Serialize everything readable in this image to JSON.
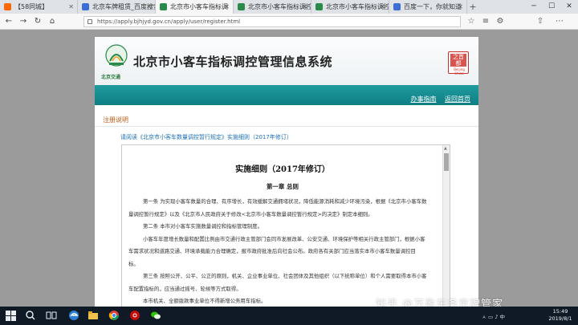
{
  "browser": {
    "tabs": [
      {
        "label": "【58同城】",
        "active": false,
        "favicon_color": "#ff6600"
      },
      {
        "label": "北京车牌租赁_百度搜索",
        "active": false,
        "favicon_color": "#3b6fd6"
      },
      {
        "label": "北京市小客车指标调",
        "active": true,
        "favicon_color": "#2a8a4a"
      },
      {
        "label": "北京市小客车指标调控",
        "active": false,
        "favicon_color": "#2a8a4a"
      },
      {
        "label": "北京市小客车指标调控",
        "active": false,
        "favicon_color": "#2a8a4a"
      },
      {
        "label": "百度一下，你就知道",
        "active": false,
        "favicon_color": "#3b6fd6"
      }
    ],
    "new_tab": "+",
    "url": "https://apply.bjhjyd.gov.cn/apply/user/register.html"
  },
  "site": {
    "logo_caption": "北京交通",
    "title": "北京市小客车指标调控管理信息系统",
    "right_logo": {
      "text": "之首都",
      "caption": "Beijing China"
    },
    "nav_links": [
      "办事指南",
      "返回首页"
    ],
    "section_heading": "注册说明",
    "notice_link": "请阅读《北京市小客车数量调控暂行规定》实施细则（2017年修订）"
  },
  "document": {
    "title": "实施细则（2017年修订）",
    "chapter": "第一章 总则",
    "lines": [
      {
        "text": "第一条 为实现小客车数量的合理、有序增长，有效缓解交通拥堵状况，降低能源消耗和减少环境污染，根据《北京市小客车数",
        "indent": true
      },
      {
        "text": "量调控暂行规定》以及《北京市人民政府关于修改<北京市小客车数量调控暂行规定>的决定》制定本细则。",
        "indent": false
      },
      {
        "text": "第二条 本市对小客车实施数量调控和指标管理制度。",
        "indent": true
      },
      {
        "text": "小客车年度增长数量和配置比例由市交通行政主管部门会同市发展改革、公安交通、环境保护等相关行政主管部门，根据小客",
        "indent": true
      },
      {
        "text": "车需求状况和道路交通、环境承载能力合理确定，报市政府批准后向社会公布。政府各有关部门应当落实本市小客车数量调控目",
        "indent": false
      },
      {
        "text": "标。",
        "indent": false
      },
      {
        "text": "第三条 按照公开、公平、公正的原则，机关、企业事业单位、社会团体及其他组织（以下统称单位）和个人需要取得本市小客",
        "indent": true
      },
      {
        "text": "车配置指标的，应当通过摇号、轮候等方式取得。",
        "indent": false
      },
      {
        "text": "本市机关、全额拨款事业单位不得新增公务用车指标。",
        "indent": true
      }
    ]
  },
  "watermark": "知乎 @万盈车务京牌管家",
  "taskbar": {
    "time": "15:49",
    "date": "2019/8/1",
    "tray_text": "ㅅ  ▭  ♪  中"
  },
  "colors": {
    "teal_bar": "#168a8f",
    "section_heading": "#c05c1a",
    "link_blue": "#1a6fb5",
    "taskbar": "#0f1a26"
  }
}
